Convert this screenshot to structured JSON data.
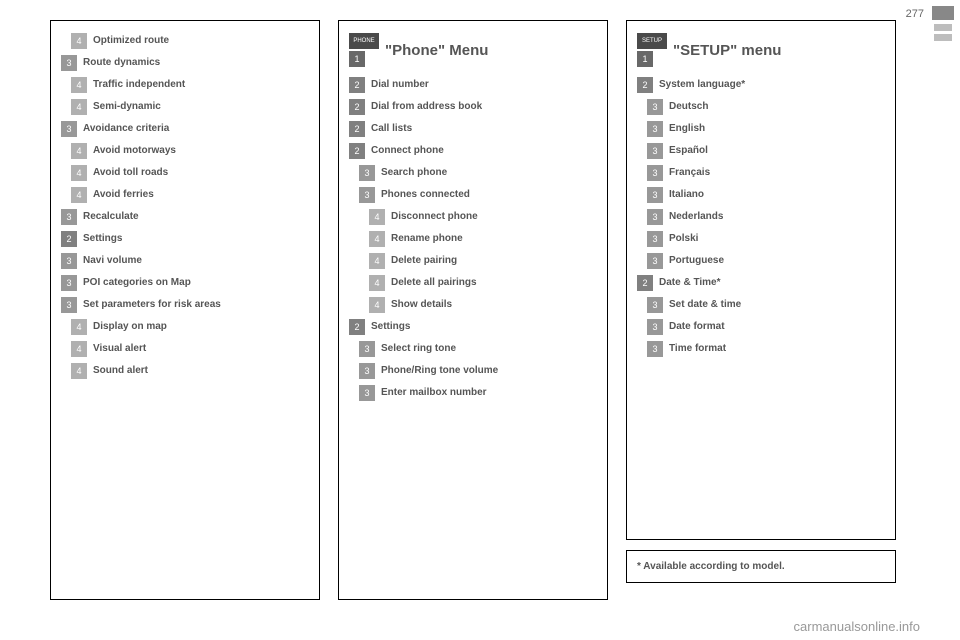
{
  "page_number": "277",
  "watermark": "carmanualsonline.info",
  "footnote": "* Available according to model.",
  "col1": {
    "items": [
      {
        "level": 4,
        "label": "Optimized route"
      },
      {
        "level": 3,
        "label": "Route dynamics"
      },
      {
        "level": 4,
        "label": "Traffic independent"
      },
      {
        "level": 4,
        "label": "Semi-dynamic"
      },
      {
        "level": 3,
        "label": "Avoidance criteria"
      },
      {
        "level": 4,
        "label": "Avoid motorways"
      },
      {
        "level": 4,
        "label": "Avoid toll roads"
      },
      {
        "level": 4,
        "label": "Avoid ferries"
      },
      {
        "level": 3,
        "label": "Recalculate"
      },
      {
        "level": 2,
        "label": "Settings"
      },
      {
        "level": 3,
        "label": "Navi volume"
      },
      {
        "level": 3,
        "label": "POI categories on Map"
      },
      {
        "level": 3,
        "label": "Set parameters for risk areas"
      },
      {
        "level": 4,
        "label": "Display on map"
      },
      {
        "level": 4,
        "label": "Visual alert"
      },
      {
        "level": 4,
        "label": "Sound alert"
      }
    ]
  },
  "col2": {
    "chip": "PHONE",
    "title": "\"Phone\" Menu",
    "items": [
      {
        "level": 2,
        "label": "Dial number"
      },
      {
        "level": 2,
        "label": "Dial from address book"
      },
      {
        "level": 2,
        "label": "Call lists"
      },
      {
        "level": 2,
        "label": "Connect phone"
      },
      {
        "level": 3,
        "label": "Search phone"
      },
      {
        "level": 3,
        "label": "Phones connected"
      },
      {
        "level": 4,
        "label": "Disconnect phone"
      },
      {
        "level": 4,
        "label": "Rename phone"
      },
      {
        "level": 4,
        "label": "Delete pairing"
      },
      {
        "level": 4,
        "label": "Delete all pairings"
      },
      {
        "level": 4,
        "label": "Show details"
      },
      {
        "level": 2,
        "label": "Settings"
      },
      {
        "level": 3,
        "label": "Select ring tone"
      },
      {
        "level": 3,
        "label": "Phone/Ring tone volume"
      },
      {
        "level": 3,
        "label": "Enter mailbox number"
      }
    ]
  },
  "col3": {
    "chip": "SETUP",
    "title": "\"SETUP\" menu",
    "items": [
      {
        "level": 2,
        "label": "System language*"
      },
      {
        "level": 3,
        "label": "Deutsch"
      },
      {
        "level": 3,
        "label": "English"
      },
      {
        "level": 3,
        "label": "Español"
      },
      {
        "level": 3,
        "label": "Français"
      },
      {
        "level": 3,
        "label": "Italiano"
      },
      {
        "level": 3,
        "label": "Nederlands"
      },
      {
        "level": 3,
        "label": "Polski"
      },
      {
        "level": 3,
        "label": "Portuguese"
      },
      {
        "level": 2,
        "label": "Date & Time*"
      },
      {
        "level": 3,
        "label": "Set date & time"
      },
      {
        "level": 3,
        "label": "Date format"
      },
      {
        "level": 3,
        "label": "Time format"
      }
    ]
  }
}
